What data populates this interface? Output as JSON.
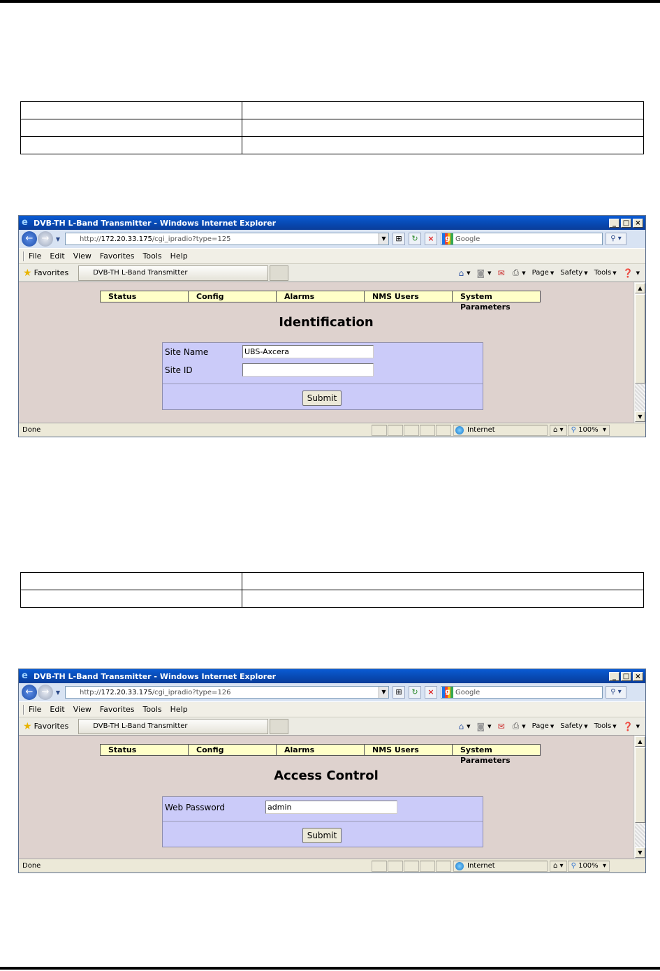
{
  "doc": {
    "table1_rows": [
      [
        "",
        ""
      ],
      [
        "",
        ""
      ],
      [
        "",
        ""
      ]
    ],
    "table2_rows": [
      [
        "",
        ""
      ],
      [
        "",
        ""
      ]
    ]
  },
  "browsers": [
    {
      "title": "DVB-TH L-Band Transmitter - Windows Internet Explorer",
      "url_prefix": "http://",
      "url_host": "172.20.33.175",
      "url_path": "/cgi_ipradio?type=125",
      "search_placeholder": "Google",
      "menu": [
        "File",
        "Edit",
        "View",
        "Favorites",
        "Tools",
        "Help"
      ],
      "favorites_label": "Favorites",
      "tab_title": "DVB-TH L-Band Transmitter",
      "commands": [
        "Page",
        "Safety",
        "Tools"
      ],
      "nav_tabs": [
        "Status",
        "Config",
        "Alarms",
        "NMS Users",
        "System Parameters"
      ],
      "heading": "Identification",
      "fields": [
        {
          "label": "Site Name",
          "value": "UBS-Axcera"
        },
        {
          "label": "Site ID",
          "value": ""
        }
      ],
      "submit_label": "Submit",
      "status_text": "Done",
      "zone_text": "Internet",
      "zoom_text": "100%"
    },
    {
      "title": "DVB-TH L-Band Transmitter - Windows Internet Explorer",
      "url_prefix": "http://",
      "url_host": "172.20.33.175",
      "url_path": "/cgi_ipradio?type=126",
      "search_placeholder": "Google",
      "menu": [
        "File",
        "Edit",
        "View",
        "Favorites",
        "Tools",
        "Help"
      ],
      "favorites_label": "Favorites",
      "tab_title": "DVB-TH L-Band Transmitter",
      "commands": [
        "Page",
        "Safety",
        "Tools"
      ],
      "nav_tabs": [
        "Status",
        "Config",
        "Alarms",
        "NMS Users",
        "System Parameters"
      ],
      "heading": "Access Control",
      "fields": [
        {
          "label": "Web Password",
          "value": "admin"
        }
      ],
      "submit_label": "Submit",
      "status_text": "Done",
      "zone_text": "Internet",
      "zoom_text": "100%"
    }
  ]
}
